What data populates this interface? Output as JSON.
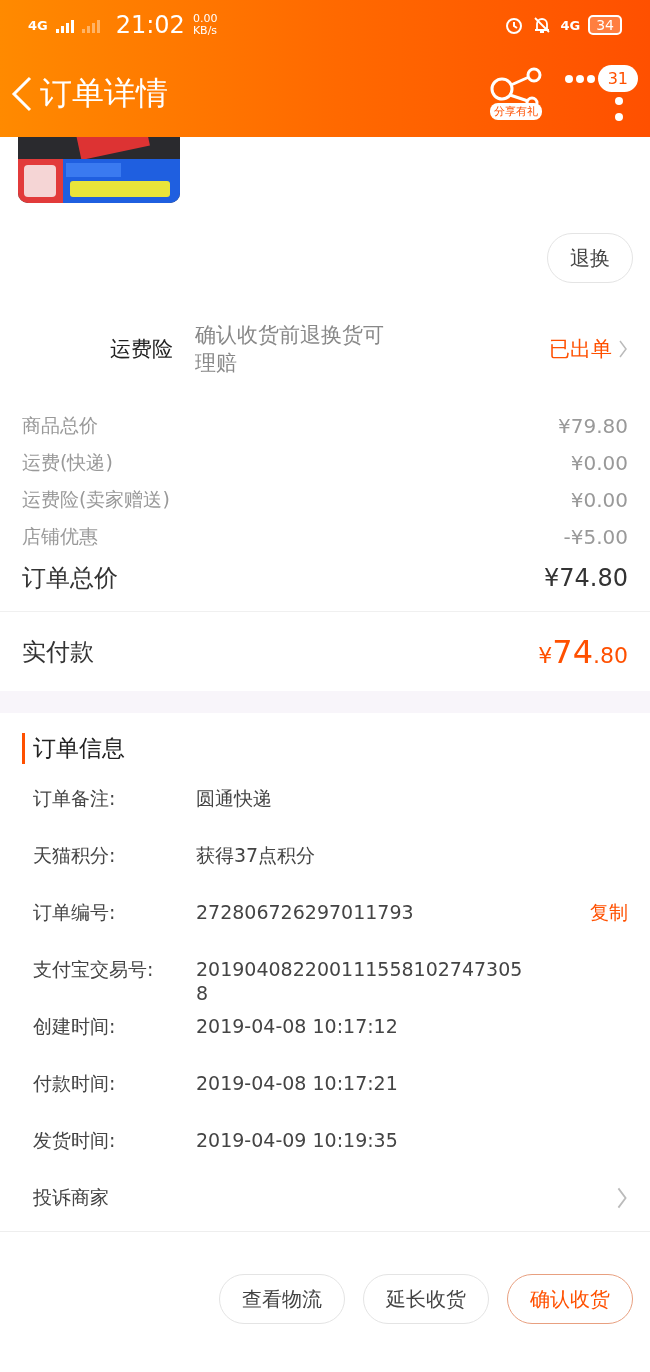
{
  "status_bar": {
    "network_left": "4G",
    "time": "21:02",
    "net_speed": "0.00",
    "net_unit": "KB/s",
    "network_right": "4G",
    "battery": "34"
  },
  "nav": {
    "title": "订单详情",
    "share_label": "分享有礼",
    "badge": "31"
  },
  "refund_button": "退换",
  "insurance": {
    "label": "运费险",
    "description": "确认收货前退换货可理赔",
    "status": "已出单"
  },
  "price_lines": [
    {
      "label": "商品总价",
      "value": "¥79.80"
    },
    {
      "label": "运费(快递)",
      "value": "¥0.00"
    },
    {
      "label": "运费险(卖家赠送)",
      "value": "¥0.00"
    },
    {
      "label": "店铺优惠",
      "value": "-¥5.00"
    }
  ],
  "order_total": {
    "label": "订单总价",
    "value": "¥74.80"
  },
  "paid": {
    "label": "实付款",
    "currency": "¥",
    "integer": "74",
    "decimal": ".80"
  },
  "order_info": {
    "title": "订单信息",
    "rows": [
      {
        "label": "订单备注:",
        "value": "圆通快递"
      },
      {
        "label": "天猫积分:",
        "value": "获得37点积分"
      },
      {
        "label": "订单编号:",
        "value": "272806726297011793",
        "action": "复制"
      },
      {
        "label": "支付宝交易号:",
        "value": "2019040822001115581027473058"
      },
      {
        "label": "创建时间:",
        "value": "2019-04-08 10:17:12"
      },
      {
        "label": "付款时间:",
        "value": "2019-04-08 10:17:21"
      },
      {
        "label": "发货时间:",
        "value": "2019-04-09 10:19:35"
      }
    ]
  },
  "complaint": "投诉商家",
  "actions": [
    {
      "label": "查看物流",
      "primary": false
    },
    {
      "label": "延长收货",
      "primary": false
    },
    {
      "label": "确认收货",
      "primary": true
    }
  ]
}
